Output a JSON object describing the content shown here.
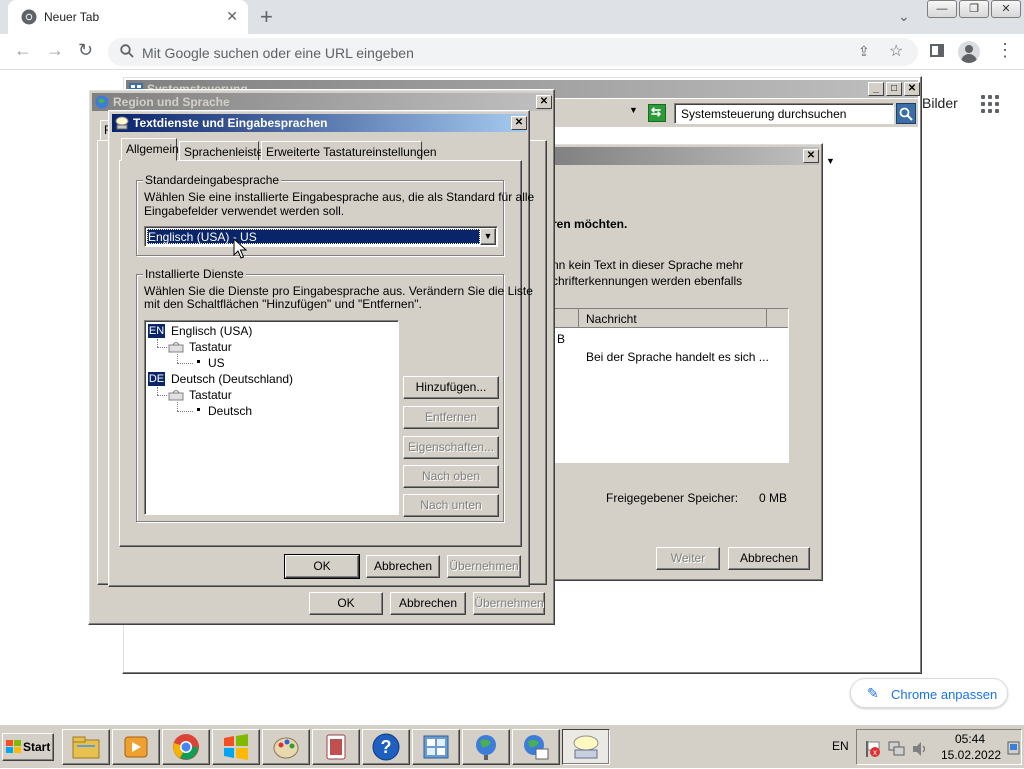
{
  "browser": {
    "tab_title": "Neuer Tab",
    "tab_close": "✕",
    "new_tab": "+",
    "tab_search": "⌄",
    "win_min": "—",
    "win_restore": "❐",
    "win_close": "✕",
    "nav_back": "←",
    "nav_forward": "→",
    "nav_reload": "↻",
    "omnibox_placeholder": "Mit Google suchen oder eine URL eingeben",
    "share": "⇪",
    "bookmark_star": "☆",
    "menu": "⋮",
    "bilder": "Bilder",
    "customize_label": "Chrome anpassen",
    "customize_icon": "✎"
  },
  "systemsteuerung": {
    "title": "Systemsteuerung",
    "search_placeholder": "Systemsteuerung durchsuchen",
    "min": "_",
    "max": "□",
    "close": "✕"
  },
  "wizard": {
    "close": "✕",
    "dropdown_arrow": "▼",
    "heading": "ren möchten.",
    "text1": "nn kein Text in dieser Sprache mehr",
    "text2": "chrifterkennungen werden ebenfalls",
    "col_header": "Nachricht",
    "row_prefix": "B",
    "row_message": "Bei der Sprache handelt es sich ...",
    "storage_label": "Freigegebener Speicher:",
    "storage_value": "0 MB",
    "next_button": "Weiter",
    "cancel_button": "Abbrechen"
  },
  "region": {
    "title": "Region und Sprache",
    "close": "✕",
    "tab_partial": "F",
    "ok": "OK",
    "cancel": "Abbrechen",
    "apply": "Übernehmen"
  },
  "textservices": {
    "title": "Textdienste und Eingabesprachen",
    "close": "✕",
    "tabs": [
      "Allgemein",
      "Sprachenleiste",
      "Erweiterte Tastatureinstellungen"
    ],
    "default_group_title": "Standardeingabesprache",
    "default_desc1": "Wählen Sie eine installierte Eingabesprache aus, die als Standard für alle",
    "default_desc2": "Eingabefelder verwendet werden soll.",
    "default_selected": "Englisch (USA) - US",
    "dropdown_arrow": "▼",
    "installed_group_title": "Installierte Dienste",
    "installed_desc1": "Wählen Sie die Dienste pro Eingabesprache aus. Verändern Sie die Liste",
    "installed_desc2": "mit den Schaltflächen \"Hinzufügen\" und \"Entfernen\".",
    "tree": {
      "lang1_badge": "EN",
      "lang1": "Englisch (USA)",
      "lang1_cat": "Tastatur",
      "lang1_item": "US",
      "lang2_badge": "DE",
      "lang2": "Deutsch (Deutschland)",
      "lang2_cat": "Tastatur",
      "lang2_item": "Deutsch"
    },
    "buttons": {
      "add": "Hinzufügen...",
      "remove": "Entfernen",
      "properties": "Eigenschaften...",
      "move_up": "Nach oben",
      "move_down": "Nach unten",
      "ok": "OK",
      "cancel": "Abbrechen",
      "apply": "Übernehmen"
    }
  },
  "taskbar": {
    "start": "Start",
    "lang": "EN",
    "time": "05:44",
    "date": "15.02.2022"
  },
  "colors": {
    "title_active_start": "#0a246a",
    "title_active_end": "#a6caf0",
    "window_face": "#d4d0c8",
    "selection": "#0a246a",
    "chrome_accent": "#1a73e8"
  }
}
